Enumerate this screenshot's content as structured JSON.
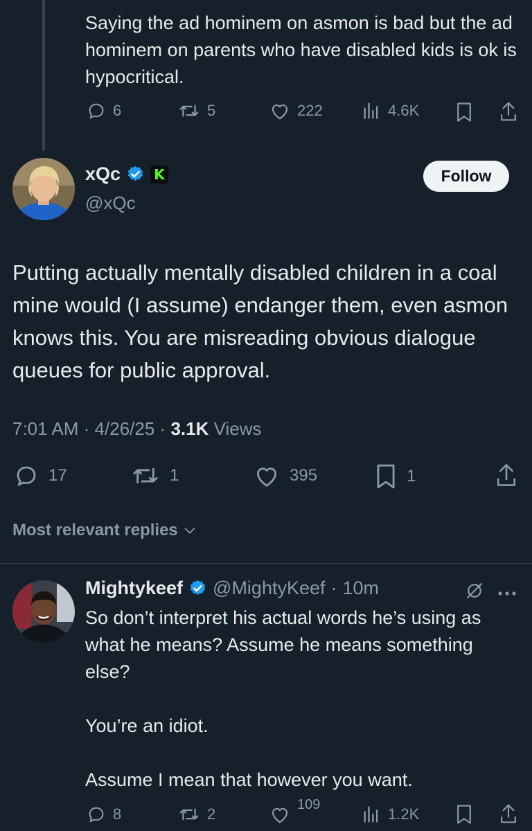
{
  "top_reply": {
    "text": "Saying the ad hominem on asmon is bad but the ad hominem  on parents who have disabled kids is ok is hypocritical.",
    "replies": "6",
    "reposts": "5",
    "likes": "222",
    "views": "4.6K"
  },
  "main_post": {
    "display_name": "xQc",
    "handle": "@xQc",
    "follow_label": "Follow",
    "text": "Putting actually mentally disabled children in a coal mine would (I assume) endanger them, even asmon knows this. You are misreading obvious dialogue queues for public approval.",
    "time": "7:01 AM",
    "sep1": "·",
    "date": "4/26/25",
    "sep2": "·",
    "views_count": "3.1K",
    "views_label": "Views",
    "replies": "17",
    "reposts": "1",
    "likes": "395",
    "bookmarks": "1",
    "badge_letter": "K"
  },
  "replies_sort": {
    "label": "Most relevant replies"
  },
  "reply": {
    "display_name": "Mightykeef",
    "handle": "@MightyKeef",
    "separator": "·",
    "time": "10m",
    "paragraphs": [
      "So don’t interpret his actual words he’s using as what he means? Assume he means something else?",
      "You’re an idiot.",
      "Assume I mean that however you want."
    ],
    "replies": "8",
    "reposts": "2",
    "likes_partial": "109",
    "views": "1.2K"
  },
  "colors": {
    "background": "#15202b",
    "text": "#e7e9ea",
    "muted": "#8b98a5",
    "verified": "#1d9bf0",
    "kick_green": "#53fc18",
    "divider": "#38444d"
  },
  "icons": [
    "reply-icon",
    "repost-icon",
    "like-icon",
    "views-icon",
    "bookmark-icon",
    "share-icon",
    "verified-icon",
    "kick-icon",
    "chevron-down-icon",
    "grok-icon",
    "more-icon"
  ]
}
